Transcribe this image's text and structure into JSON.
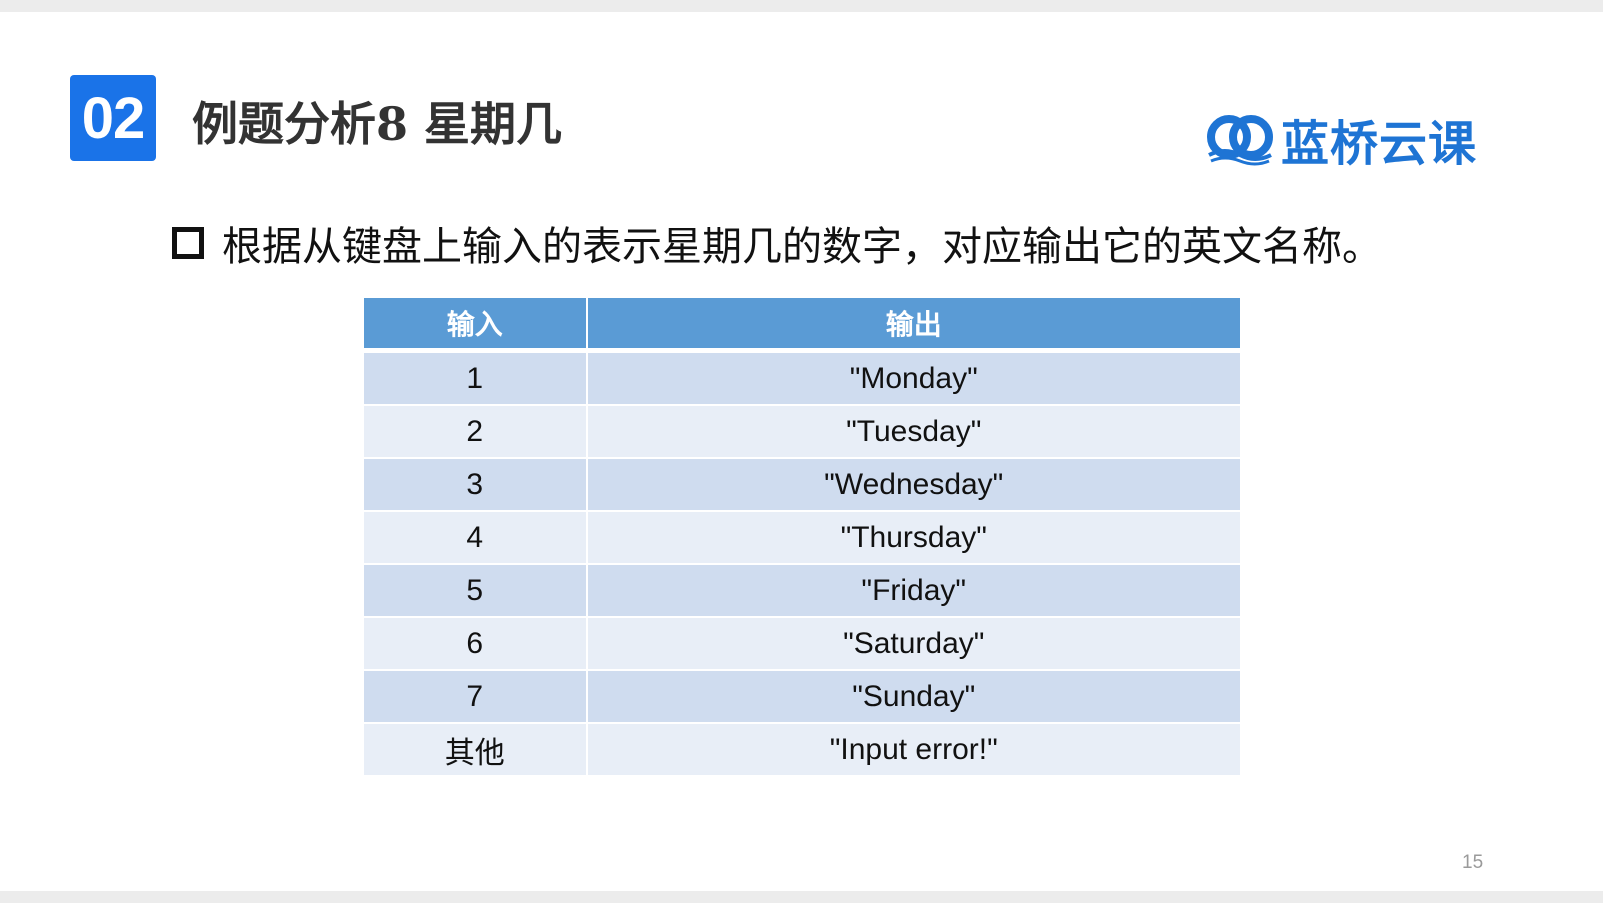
{
  "header": {
    "section_number": "02",
    "title": "例题分析8 星期几"
  },
  "logo": {
    "text": "蓝桥云课",
    "icon": "lanqiao-logo-icon",
    "color": "#1e74d4"
  },
  "bullet": {
    "icon": "hollow-square-bullet-icon",
    "text": "根据从键盘上输入的表示星期几的数字，对应输出它的英文名称。"
  },
  "table": {
    "columns": [
      "输入",
      "输出"
    ],
    "rows": [
      [
        "1",
        "\"Monday\""
      ],
      [
        "2",
        "\"Tuesday\""
      ],
      [
        "3",
        "\"Wednesday\""
      ],
      [
        "4",
        "\"Thursday\""
      ],
      [
        "5",
        "\"Friday\""
      ],
      [
        "6",
        "\"Saturday\""
      ],
      [
        "7",
        "\"Sunday\""
      ],
      [
        "其他",
        "\"Input error!\""
      ]
    ],
    "header_color": "#5a9bd5",
    "row_colors": [
      "#cfdcef",
      "#e8eef7"
    ]
  },
  "footer": {
    "page_number": "15"
  },
  "colors": {
    "badge": "#1a73e8"
  }
}
